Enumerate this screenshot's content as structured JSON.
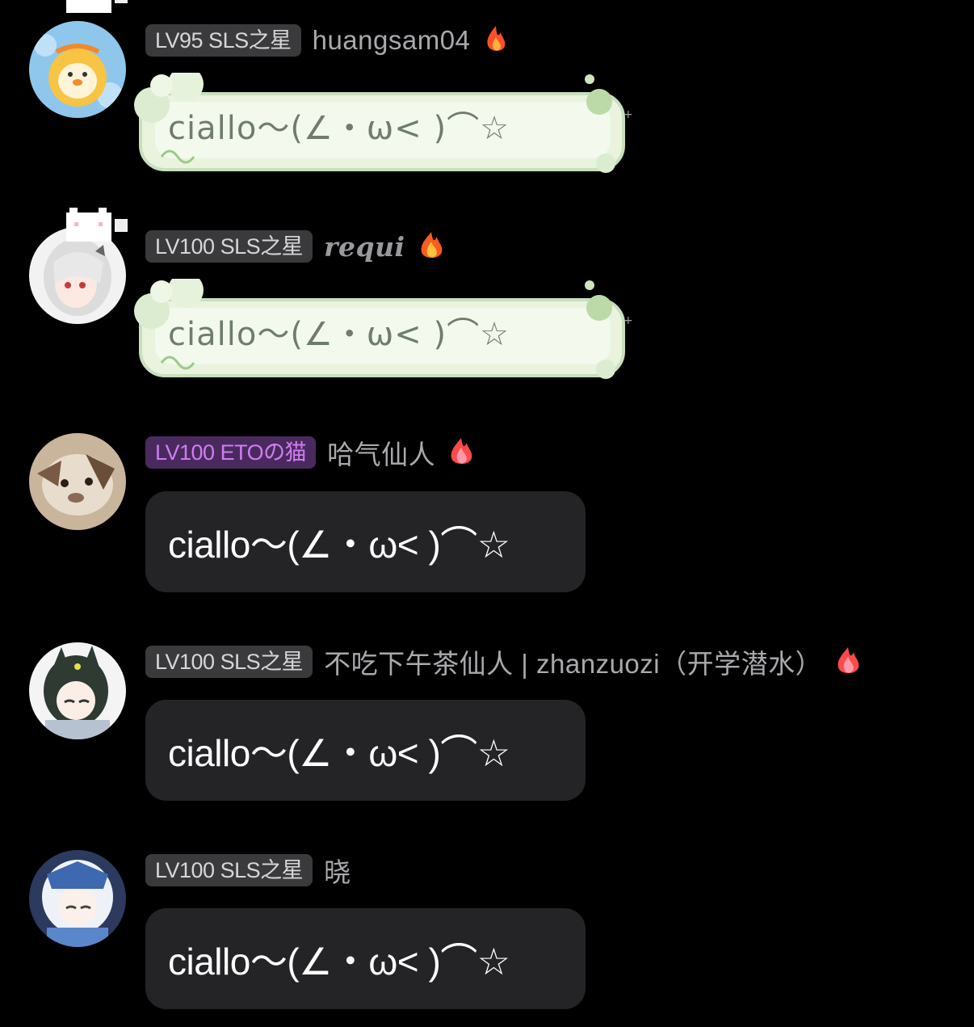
{
  "messages": [
    {
      "badge": "LV95 SLS之星",
      "username": "huangsam04",
      "text": "ciallo～(∠・ω< )⌒☆",
      "avatar_icon": "yellow-duck-avatar",
      "bubble_style": "green-cloud"
    },
    {
      "badge": "LV100 SLS之星",
      "username": "requi",
      "text": "ciallo～(∠・ω< )⌒☆",
      "avatar_icon": "white-hair-girl-avatar",
      "bubble_style": "green-cloud"
    },
    {
      "badge": "LV100 ETOの猫",
      "username": "哈气仙人",
      "text": "ciallo～(∠・ω< )⌒☆",
      "avatar_icon": "cat-photo-avatar",
      "bubble_style": "plain",
      "badge_color": "#d07cf0"
    },
    {
      "badge": "LV100 SLS之星",
      "username": "不吃下午茶仙人 | zhanzuozi（开学潜水）",
      "text": "ciallo～(∠・ω< )⌒☆",
      "avatar_icon": "green-hair-girl-avatar",
      "bubble_style": "plain"
    },
    {
      "badge": "LV100 SLS之星",
      "username": "晓",
      "text": "ciallo～(∠・ω< )⌒☆",
      "avatar_icon": "white-hair-blue-outfit-avatar",
      "bubble_style": "plain"
    }
  ],
  "colors": {
    "background": "#000000",
    "badge_bg": "#3a3a3c",
    "bubble_bg": "#242426",
    "username": "#a9a9ad",
    "flame": "#ff5a2a"
  }
}
